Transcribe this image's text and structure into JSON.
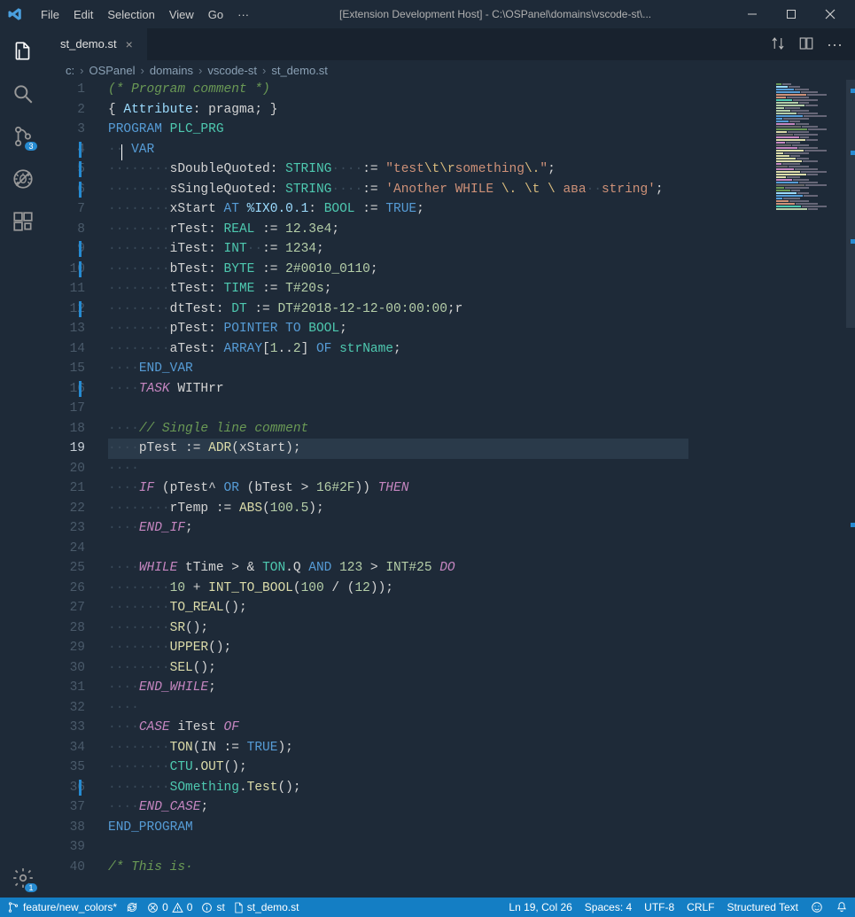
{
  "titlebar": {
    "menu": [
      "File",
      "Edit",
      "Selection",
      "View",
      "Go"
    ],
    "overflow": "···",
    "title": "[Extension Development Host] - C:\\OSPanel\\domains\\vscode-st\\..."
  },
  "activity": {
    "scm_badge": "3",
    "gear_badge": "1"
  },
  "tab": {
    "name": "st_demo.st"
  },
  "breadcrumb": {
    "root": "c:",
    "p1": "OSPanel",
    "p2": "domains",
    "p3": "vscode-st",
    "file": "st_demo.st"
  },
  "code": {
    "lines": [
      {
        "n": 1,
        "html": "<span class='tok-comment'>(* Program comment *)</span>"
      },
      {
        "n": 2,
        "html": "<span class='tok-punc'>{ </span><span class='tok-var'>Attribute</span><span class='tok-punc'>: </span><span class='tok-ident'>pragma</span><span class='tok-punc'>; }</span>"
      },
      {
        "n": 3,
        "html": "<span class='tok-kw2'>PROGRAM</span> <span class='tok-type'>PLC_PRG</span>"
      },
      {
        "n": 4,
        "mod": true,
        "html": "<span class='ws'>··</span><span class='tok-ident' style='position:relative'><span class='cursor-beam' style='left:-2px'></span> </span><span class='tok-kw2'>VAR</span>"
      },
      {
        "n": 5,
        "mod": true,
        "html": "<span class='ws'>········</span><span class='tok-ident'>sDoubleQuoted</span><span class='tok-punc'>:</span> <span class='tok-type'>STRING</span><span class='ws'>····</span><span class='tok-op'>:=</span> <span class='tok-str'>\"test</span><span class='tok-esc'>\\t\\r</span><span class='tok-str'>something</span><span class='tok-esc'>\\.</span><span class='tok-str'>\"</span><span class='tok-punc'>;</span>"
      },
      {
        "n": 6,
        "mod": true,
        "html": "<span class='ws'>········</span><span class='tok-ident'>sSingleQuoted</span><span class='tok-punc'>:</span> <span class='tok-type'>STRING</span><span class='ws'>····</span><span class='tok-op'>:=</span> <span class='tok-str'>'Another WHILE </span><span class='tok-esc'>\\.</span><span class='tok-str'> </span><span class='tok-esc'>\\t</span><span class='tok-str'> </span><span class='tok-esc'>\\</span><span class='tok-str'> ава</span><span class='ws'>··</span><span class='tok-str'>string'</span><span class='tok-punc'>;</span>"
      },
      {
        "n": 7,
        "html": "<span class='ws'>········</span><span class='tok-ident'>xStart</span> <span class='tok-kw2'>AT</span> <span class='tok-var'>%IX0.0.1</span><span class='tok-punc'>:</span> <span class='tok-type'>BOOL</span> <span class='tok-op'>:=</span> <span class='tok-const'>TRUE</span><span class='tok-punc'>;</span>"
      },
      {
        "n": 8,
        "html": "<span class='ws'>········</span><span class='tok-ident'>rTest</span><span class='tok-punc'>:</span> <span class='tok-type'>REAL</span> <span class='tok-op'>:=</span> <span class='tok-num'>12.3e4</span><span class='tok-punc'>;</span>"
      },
      {
        "n": 9,
        "mod": true,
        "html": "<span class='ws'>········</span><span class='tok-ident'>iTest</span><span class='tok-punc'>:</span> <span class='tok-type'>INT</span><span class='ws'>··</span><span class='tok-op'>:=</span> <span class='tok-num'>1234</span><span class='tok-punc'>;</span>"
      },
      {
        "n": 10,
        "mod": true,
        "html": "<span class='ws'>········</span><span class='tok-ident'>bTest</span><span class='tok-punc'>:</span> <span class='tok-type'>BYTE</span> <span class='tok-op'>:=</span> <span class='tok-num'>2#0010_0110</span><span class='tok-punc'>;</span>"
      },
      {
        "n": 11,
        "html": "<span class='ws'>········</span><span class='tok-ident'>tTest</span><span class='tok-punc'>:</span> <span class='tok-type'>TIME</span> <span class='tok-op'>:=</span> <span class='tok-num'>T#20s</span><span class='tok-punc'>;</span>"
      },
      {
        "n": 12,
        "mod": true,
        "html": "<span class='ws'>········</span><span class='tok-ident'>dtTest</span><span class='tok-punc'>:</span> <span class='tok-type'>DT</span> <span class='tok-op'>:=</span> <span class='tok-num'>DT#2018-12-12-00:00:00</span><span class='tok-punc'>;</span><span class='tok-ident'>r</span>"
      },
      {
        "n": 13,
        "html": "<span class='ws'>········</span><span class='tok-ident'>pTest</span><span class='tok-punc'>:</span> <span class='tok-kw2'>POINTER TO</span> <span class='tok-type'>BOOL</span><span class='tok-punc'>;</span>"
      },
      {
        "n": 14,
        "html": "<span class='ws'>········</span><span class='tok-ident'>aTest</span><span class='tok-punc'>:</span> <span class='tok-kw2'>ARRAY</span><span class='tok-punc'>[</span><span class='tok-num'>1</span><span class='tok-punc'>..</span><span class='tok-num'>2</span><span class='tok-punc'>]</span> <span class='tok-kw2'>OF</span> <span class='tok-type'>strName</span><span class='tok-punc'>;</span>"
      },
      {
        "n": 15,
        "html": "<span class='ws'>····</span><span class='tok-kw2'>END_VAR</span>"
      },
      {
        "n": 16,
        "mod": true,
        "html": "<span class='ws'>····</span><span class='tok-kw'>TASK</span> <span class='tok-ident'>WITHrr</span>"
      },
      {
        "n": 17,
        "html": ""
      },
      {
        "n": 18,
        "html": "<span class='ws'>····</span><span class='tok-comment'>// Single line comment</span>"
      },
      {
        "n": 19,
        "current": true,
        "html": "<span class='ws'>····</span><span class='tok-ident'>pTest</span> <span class='tok-op'>:=</span> <span class='tok-func'>ADR</span><span class='tok-punc'>(</span><span class='tok-ident'>xStart</span><span class='tok-punc'>);</span>"
      },
      {
        "n": 20,
        "html": "<span class='ws'>····</span>"
      },
      {
        "n": 21,
        "html": "<span class='ws'>····</span><span class='tok-kw'>IF</span> <span class='tok-punc'>(</span><span class='tok-ident'>pTest^</span> <span class='tok-kw2'>OR</span> <span class='tok-punc'>(</span><span class='tok-ident'>bTest</span> <span class='tok-op'>&gt;</span> <span class='tok-num'>16#2F</span><span class='tok-punc'>))</span> <span class='tok-kw'>THEN</span>"
      },
      {
        "n": 22,
        "html": "<span class='ws'>········</span><span class='tok-ident'>rTemp</span> <span class='tok-op'>:=</span> <span class='tok-func'>ABS</span><span class='tok-punc'>(</span><span class='tok-num'>100.5</span><span class='tok-punc'>);</span>"
      },
      {
        "n": 23,
        "html": "<span class='ws'>····</span><span class='tok-kw'>END_IF</span><span class='tok-punc'>;</span>"
      },
      {
        "n": 24,
        "html": ""
      },
      {
        "n": 25,
        "html": "<span class='ws'>····</span><span class='tok-kw'>WHILE</span> <span class='tok-ident'>tTime</span> <span class='tok-op'>&gt;</span> <span class='tok-op'>&amp;</span> <span class='tok-type'>TON</span><span class='tok-punc'>.</span><span class='tok-ident'>Q</span> <span class='tok-kw2'>AND</span> <span class='tok-num'>123</span> <span class='tok-op'>&gt;</span> <span class='tok-num'>INT#25</span> <span class='tok-kw'>DO</span>"
      },
      {
        "n": 26,
        "html": "<span class='ws'>········</span><span class='tok-num'>10</span> <span class='tok-op'>+</span> <span class='tok-func'>INT_TO_BOOL</span><span class='tok-punc'>(</span><span class='tok-num'>100</span> <span class='tok-op'>/</span> <span class='tok-punc'>(</span><span class='tok-num'>12</span><span class='tok-punc'>));</span>"
      },
      {
        "n": 27,
        "html": "<span class='ws'>········</span><span class='tok-func'>TO_REAL</span><span class='tok-punc'>();</span>"
      },
      {
        "n": 28,
        "html": "<span class='ws'>········</span><span class='tok-func'>SR</span><span class='tok-punc'>();</span>"
      },
      {
        "n": 29,
        "html": "<span class='ws'>········</span><span class='tok-func'>UPPER</span><span class='tok-punc'>();</span>"
      },
      {
        "n": 30,
        "html": "<span class='ws'>········</span><span class='tok-func'>SEL</span><span class='tok-punc'>();</span>"
      },
      {
        "n": 31,
        "html": "<span class='ws'>····</span><span class='tok-kw'>END_WHILE</span><span class='tok-punc'>;</span>"
      },
      {
        "n": 32,
        "html": "<span class='ws'>····</span>"
      },
      {
        "n": 33,
        "html": "<span class='ws'>····</span><span class='tok-kw'>CASE</span> <span class='tok-ident'>iTest</span> <span class='tok-kw'>OF</span>"
      },
      {
        "n": 34,
        "html": "<span class='ws'>········</span><span class='tok-func'>TON</span><span class='tok-punc'>(</span><span class='tok-ident'>IN</span> <span class='tok-op'>:=</span> <span class='tok-const'>TRUE</span><span class='tok-punc'>);</span>"
      },
      {
        "n": 35,
        "html": "<span class='ws'>········</span><span class='tok-type'>CTU</span><span class='tok-punc'>.</span><span class='tok-func'>OUT</span><span class='tok-punc'>();</span>"
      },
      {
        "n": 36,
        "mod": true,
        "html": "<span class='ws'>········</span><span class='tok-type'>SOmething</span><span class='tok-punc'>.</span><span class='tok-func'>Test</span><span class='tok-punc'>();</span>"
      },
      {
        "n": 37,
        "html": "<span class='ws'>····</span><span class='tok-kw'>END_CASE</span><span class='tok-punc'>;</span>"
      },
      {
        "n": 38,
        "html": "<span class='tok-kw2'>END_PROGRAM</span>"
      },
      {
        "n": 39,
        "html": ""
      },
      {
        "n": 40,
        "html": "<span class='tok-comment'>/* This is·</span>"
      }
    ]
  },
  "statusbar": {
    "branch": "feature/new_colors*",
    "errors": "0",
    "warnings": "0",
    "info": "st",
    "file": "st_demo.st",
    "cursor": "Ln 19, Col 26",
    "spaces": "Spaces: 4",
    "encoding": "UTF-8",
    "eol": "CRLF",
    "language": "Structured Text"
  }
}
